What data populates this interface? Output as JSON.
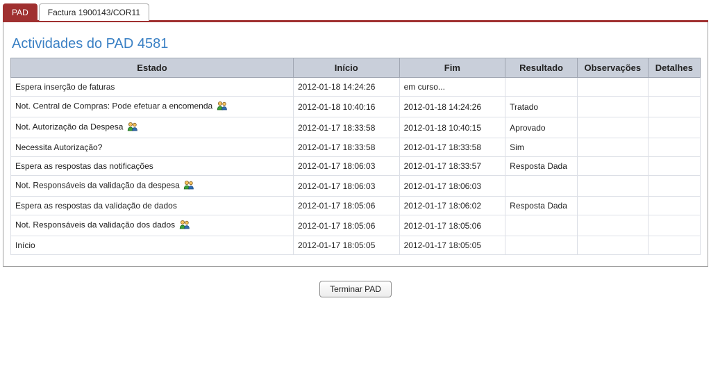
{
  "tabs": [
    {
      "label": "PAD",
      "active": true
    },
    {
      "label": "Factura 1900143/COR11",
      "active": false
    }
  ],
  "title": "Actividades do PAD 4581",
  "columns": {
    "estado": "Estado",
    "inicio": "Início",
    "fim": "Fim",
    "resultado": "Resultado",
    "observacoes": "Observações",
    "detalhes": "Detalhes"
  },
  "rows": [
    {
      "estado": "Espera inserção de faturas",
      "icon": false,
      "inicio": "2012-01-18 14:24:26",
      "fim": "em curso...",
      "resultado": "",
      "observacoes": "",
      "detalhes": ""
    },
    {
      "estado": "Not. Central de Compras: Pode efetuar a encomenda",
      "icon": true,
      "inicio": "2012-01-18 10:40:16",
      "fim": "2012-01-18 14:24:26",
      "resultado": "Tratado",
      "observacoes": "",
      "detalhes": ""
    },
    {
      "estado": "Not. Autorização da Despesa",
      "icon": true,
      "inicio": "2012-01-17 18:33:58",
      "fim": "2012-01-18 10:40:15",
      "resultado": "Aprovado",
      "observacoes": "",
      "detalhes": ""
    },
    {
      "estado": "Necessita Autorização?",
      "icon": false,
      "inicio": "2012-01-17 18:33:58",
      "fim": "2012-01-17 18:33:58",
      "resultado": "Sim",
      "observacoes": "",
      "detalhes": ""
    },
    {
      "estado": "Espera as respostas das notificações",
      "icon": false,
      "inicio": "2012-01-17 18:06:03",
      "fim": "2012-01-17 18:33:57",
      "resultado": "Resposta Dada",
      "observacoes": "",
      "detalhes": ""
    },
    {
      "estado": "Not. Responsáveis da validação da despesa",
      "icon": true,
      "inicio": "2012-01-17 18:06:03",
      "fim": "2012-01-17 18:06:03",
      "resultado": "",
      "observacoes": "",
      "detalhes": ""
    },
    {
      "estado": "Espera as respostas da validação de dados",
      "icon": false,
      "inicio": "2012-01-17 18:05:06",
      "fim": "2012-01-17 18:06:02",
      "resultado": "Resposta Dada",
      "observacoes": "",
      "detalhes": ""
    },
    {
      "estado": "Not. Responsáveis da validação dos dados",
      "icon": true,
      "inicio": "2012-01-17 18:05:06",
      "fim": "2012-01-17 18:05:06",
      "resultado": "",
      "observacoes": "",
      "detalhes": ""
    },
    {
      "estado": "Início",
      "icon": false,
      "inicio": "2012-01-17 18:05:05",
      "fim": "2012-01-17 18:05:05",
      "resultado": "",
      "observacoes": "",
      "detalhes": ""
    }
  ],
  "buttons": {
    "terminar": "Terminar PAD"
  }
}
